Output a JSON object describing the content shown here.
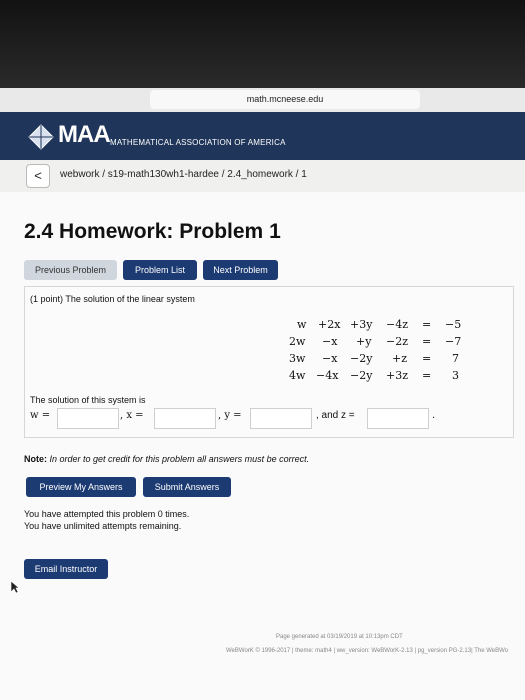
{
  "browser": {
    "url": "math.mcneese.edu"
  },
  "header": {
    "logo_text": "MAA",
    "org_name": "MATHEMATICAL ASSOCIATION OF AMERICA",
    "color": "#1f3559"
  },
  "breadcrumb": {
    "back_symbol": "<",
    "path": "webwork / s19-math130wh1-hardee / 2.4_homework / 1"
  },
  "page": {
    "title": "2.4 Homework: Problem 1",
    "nav": {
      "previous": "Previous Problem",
      "list": "Problem List",
      "next": "Next Problem"
    }
  },
  "problem": {
    "statement": "(1 point) The solution of the linear system",
    "system": [
      [
        "w",
        "+2x",
        "+3y",
        "−4z",
        "=",
        "−5"
      ],
      [
        "2w",
        "−x",
        "+y",
        "−2z",
        "=",
        "−7"
      ],
      [
        "3w",
        "−x",
        "−2y",
        "+z",
        "=",
        "7"
      ],
      [
        "4w",
        "−4x",
        "−2y",
        "+3z",
        "=",
        "3"
      ]
    ],
    "solution_intro": "The solution of this system is",
    "answers": {
      "w_label": "w =",
      "x_label": ", x =",
      "y_label": ", y =",
      "z_label": ", and z =",
      "end": "."
    }
  },
  "note": {
    "bold": "Note:",
    "text": " In order to get credit for this problem all answers must be correct."
  },
  "actions": {
    "preview": "Preview My Answers",
    "submit": "Submit Answers"
  },
  "status": {
    "line1": "You have attempted this problem 0 times.",
    "line2": "You have unlimited attempts remaining."
  },
  "email": {
    "label": "Email Instructor"
  },
  "footer": {
    "generated": "Page generated at 03/19/2019 at 10:13pm CDT",
    "copyright": "WeBWorK © 1996-2017 | theme: math4 | ww_version: WeBWorK-2.13 | pg_version PG-2.13| The WeBWo"
  },
  "colors": {
    "button": "#1d3b73",
    "button_disabled": "#cfd6de",
    "header": "#1f3559"
  }
}
